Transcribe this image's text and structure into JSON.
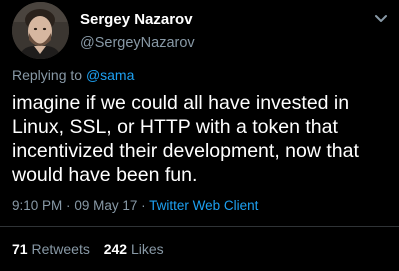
{
  "author": {
    "display_name": "Sergey Nazarov",
    "handle": "@SergeyNazarov"
  },
  "reply": {
    "prefix": "Replying to",
    "mention": "@sama"
  },
  "tweet": {
    "line1": "imagine if we could all have invested in",
    "line2": "Linux, SSL, or HTTP with a token that",
    "line3": "incentivized their development, now that",
    "line4": "would have been fun."
  },
  "meta": {
    "time": "9:10 PM",
    "separator": "·",
    "date": "09 May 17",
    "client": "Twitter Web Client"
  },
  "stats": {
    "retweets_count": "71",
    "retweets_label": "Retweets",
    "likes_count": "242",
    "likes_label": "Likes"
  },
  "icons": {
    "menu": "chevron-down-icon"
  },
  "colors": {
    "background": "#000000",
    "text": "#ffffff",
    "secondary": "#8899a6",
    "accent": "#1da1f2"
  }
}
